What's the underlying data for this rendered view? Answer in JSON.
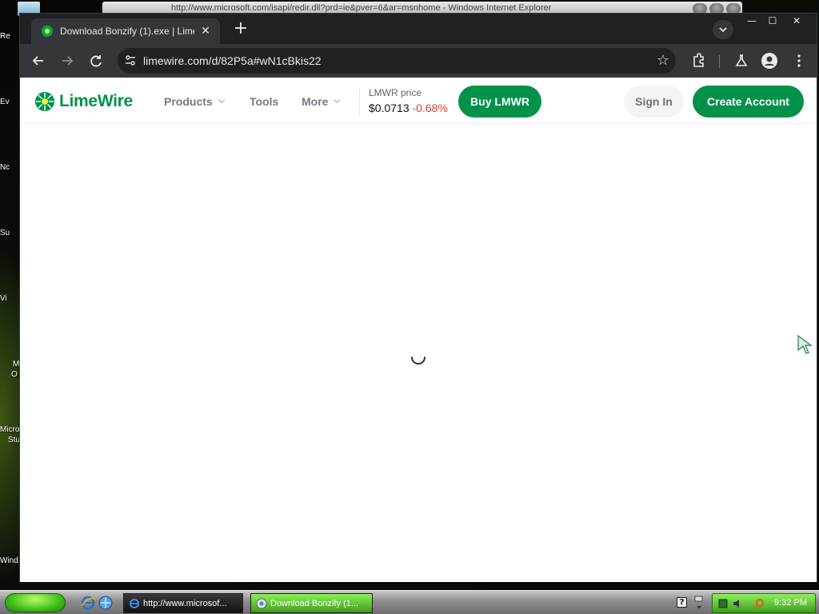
{
  "desktop": {
    "icon_labels": [
      "Re",
      "Ev",
      "Nc",
      "Su",
      "Vi",
      "M",
      "O",
      "Micro",
      "Stu",
      "Wind"
    ]
  },
  "background_window": {
    "title": "http://www.microsoft.com/isapi/redir.dll?prd=ie&pver=6&ar=msnhome - Windows Internet Explorer"
  },
  "browser": {
    "tab": {
      "title": "Download Bonzify (1).exe | LimeWire"
    },
    "url": "limewire.com/d/82P5a#wN1cBkis22"
  },
  "site": {
    "brand": "LimeWire",
    "nav": [
      {
        "label": "Products"
      },
      {
        "label": "Tools"
      },
      {
        "label": "More"
      }
    ],
    "price": {
      "label": "LMWR price",
      "value": "$0.0713",
      "change": "-0.68%"
    },
    "buy_label": "Buy LMWR",
    "signin_label": "Sign In",
    "create_label": "Create Account"
  },
  "taskbar": {
    "tasks": [
      {
        "label": "http://www.microsof..."
      },
      {
        "label": "Download Bonzify (1..."
      }
    ],
    "clock": "9:32 PM"
  },
  "colors": {
    "brand_green": "#00924a",
    "price_change_red": "#e0403a",
    "chrome_dark": "#202124"
  }
}
